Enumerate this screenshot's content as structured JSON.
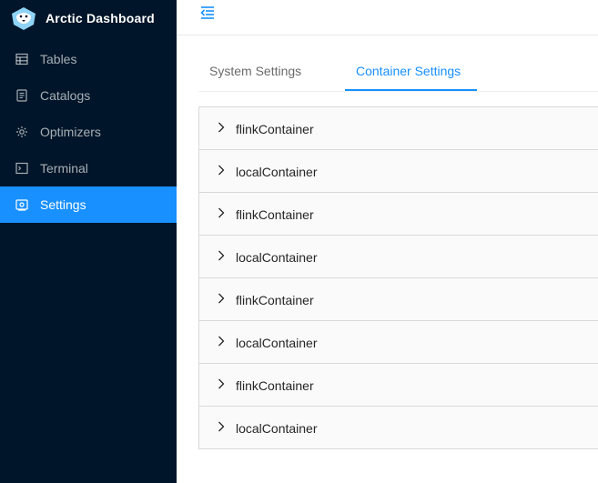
{
  "app": {
    "title": "Arctic Dashboard"
  },
  "sidebar": {
    "items": [
      {
        "label": "Tables",
        "icon": "table-icon"
      },
      {
        "label": "Catalogs",
        "icon": "catalog-icon"
      },
      {
        "label": "Optimizers",
        "icon": "optimizer-icon"
      },
      {
        "label": "Terminal",
        "icon": "terminal-icon"
      },
      {
        "label": "Settings",
        "icon": "settings-icon",
        "active": true
      }
    ]
  },
  "colors": {
    "sidebar_bg": "#001529",
    "accent": "#1890ff"
  },
  "tabs": [
    {
      "label": "System Settings"
    },
    {
      "label": "Container Settings",
      "active": true
    }
  ],
  "containers": [
    {
      "label": "flinkContainer"
    },
    {
      "label": "localContainer"
    },
    {
      "label": "flinkContainer"
    },
    {
      "label": "localContainer"
    },
    {
      "label": "flinkContainer"
    },
    {
      "label": "localContainer"
    },
    {
      "label": "flinkContainer"
    },
    {
      "label": "localContainer"
    }
  ]
}
